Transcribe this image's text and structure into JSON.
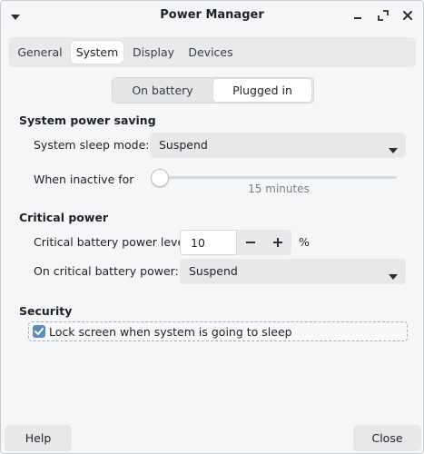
{
  "window": {
    "title": "Power Manager"
  },
  "tabs": [
    {
      "label": "General"
    },
    {
      "label": "System"
    },
    {
      "label": "Display"
    },
    {
      "label": "Devices"
    }
  ],
  "active_tab": "System",
  "power_source": {
    "options": [
      "On battery",
      "Plugged in"
    ],
    "selected": "Plugged in"
  },
  "system_power_saving": {
    "heading": "System power saving",
    "sleep_mode_label": "System sleep mode:",
    "sleep_mode_value": "Suspend",
    "inactive_label": "When inactive for",
    "inactive_value_text": "15 minutes",
    "inactive_slider_fraction": 0
  },
  "critical_power": {
    "heading": "Critical power",
    "level_label": "Critical battery power level:",
    "level_value": "10",
    "level_unit": "%",
    "action_label": "On critical battery power:",
    "action_value": "Suspend"
  },
  "security": {
    "heading": "Security",
    "lock_screen_label": "Lock screen when system is going to sleep",
    "lock_screen_checked": true
  },
  "footer": {
    "help_label": "Help",
    "close_label": "Close"
  },
  "icons": {
    "menu": "window-menu-icon",
    "minimize": "minimize-icon",
    "maximize": "maximize-icon",
    "close": "close-icon",
    "dropdown": "chevron-down-icon",
    "minus": "minus-icon",
    "plus": "plus-icon",
    "check": "check-icon"
  },
  "colors": {
    "accent": "#5c8db8",
    "window_bg": "#f5f6f7",
    "control_bg": "#e6e8ea"
  }
}
